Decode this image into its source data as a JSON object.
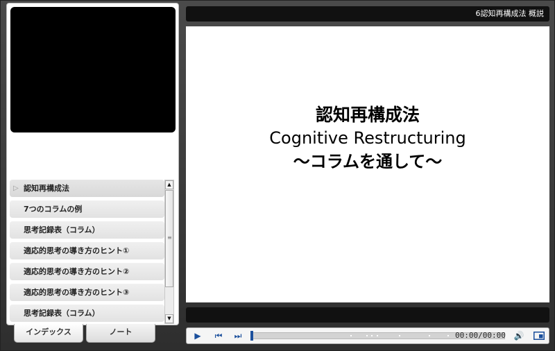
{
  "header": {
    "title": "6認知再構成法 概説"
  },
  "slide": {
    "title_jp": "認知再構成法",
    "title_en": "Cognitive Restructuring",
    "subtitle": "～コラムを通して～"
  },
  "index": {
    "items": [
      {
        "label": "認知再構成法",
        "active": true
      },
      {
        "label": "7つのコラムの例"
      },
      {
        "label": "思考記録表（コラム）"
      },
      {
        "label": "適応的思考の導き方のヒント①"
      },
      {
        "label": "適応的思考の導き方のヒント②"
      },
      {
        "label": "適応的思考の導き方のヒント③"
      },
      {
        "label": "思考記録表（コラム）"
      }
    ]
  },
  "tabs": {
    "index": "インデックス",
    "note": "ノート"
  },
  "player": {
    "time": "00:00/00:00",
    "progress": 0,
    "icons": {
      "play": "play-icon",
      "prev": "skip-back-icon",
      "next": "skip-forward-icon",
      "volume": "volume-icon",
      "layout": "layout-toggle-icon"
    }
  },
  "colors": {
    "accent": "#1b4f9c",
    "bar": "#111111"
  }
}
